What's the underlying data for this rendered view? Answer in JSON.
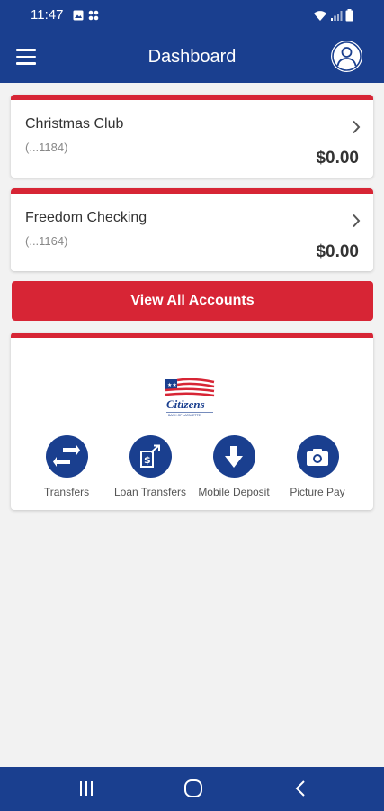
{
  "status_bar": {
    "time": "11:47",
    "icons_left": [
      "image-icon",
      "grid-icon"
    ],
    "icons_right": [
      "wifi-icon",
      "signal-icon",
      "battery-icon"
    ]
  },
  "app_bar": {
    "title": "Dashboard",
    "menu_icon": "hamburger-icon",
    "profile_icon": "profile-icon"
  },
  "accounts": [
    {
      "name": "Christmas Club",
      "number": "(...1184)",
      "balance": "$0.00"
    },
    {
      "name": "Freedom Checking",
      "number": "(...1164)",
      "balance": "$0.00"
    }
  ],
  "view_all_label": "View All Accounts",
  "logo": {
    "name": "Citizens",
    "tagline": "BANK OF LAFAYETTE"
  },
  "quick_actions": [
    {
      "label": "Transfers",
      "icon": "transfer-arrows-icon"
    },
    {
      "label": "Loan Transfers",
      "icon": "loan-transfer-icon"
    },
    {
      "label": "Mobile Deposit",
      "icon": "download-arrow-icon"
    },
    {
      "label": "Picture Pay",
      "icon": "camera-icon"
    }
  ],
  "nav_bar": {
    "buttons": [
      "recents-icon",
      "home-icon",
      "back-icon"
    ]
  },
  "colors": {
    "primary_blue": "#1a3f8f",
    "accent_red": "#d72535",
    "background": "#f2f2f2"
  }
}
